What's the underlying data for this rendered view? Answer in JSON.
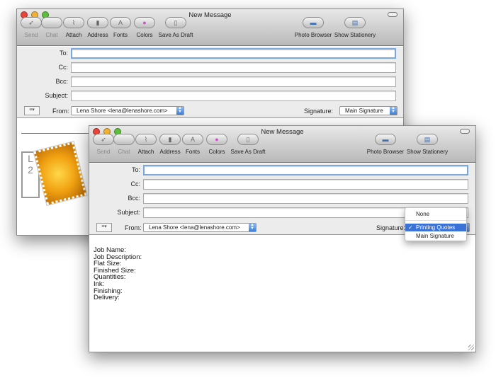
{
  "colors": {
    "close": "#e8443a",
    "minimize": "#f0b234",
    "zoom": "#5dbf3b",
    "accent": "#3a72d8"
  },
  "window_title": "New Message",
  "toolbar": {
    "left": [
      {
        "label": "Send",
        "icon": "send-icon",
        "enabled": false
      },
      {
        "label": "Chat",
        "icon": "chat-icon",
        "enabled": false
      },
      {
        "label": "Attach",
        "icon": "paperclip-icon",
        "enabled": true
      },
      {
        "label": "Address",
        "icon": "address-book-icon",
        "enabled": true
      },
      {
        "label": "Fonts",
        "icon": "fonts-icon",
        "enabled": true
      },
      {
        "label": "Colors",
        "icon": "color-wheel-icon",
        "enabled": true
      },
      {
        "label": "Save As Draft",
        "icon": "draft-icon",
        "enabled": true
      }
    ],
    "right": [
      {
        "label": "Photo Browser",
        "icon": "photo-icon"
      },
      {
        "label": "Show Stationery",
        "icon": "stationery-icon"
      }
    ]
  },
  "fields": {
    "to": "To:",
    "cc": "Cc:",
    "bcc": "Bcc:",
    "subject": "Subject:",
    "from": "From:",
    "signature": "Signature:"
  },
  "from_value": "Lena Shore <lena@lenashore.com>",
  "back_window": {
    "signature_value": "Main Signature"
  },
  "front_window": {
    "signature_menu": {
      "options": [
        "None",
        "Printing Quotes",
        "Main Signature"
      ],
      "selected": "Printing Quotes"
    },
    "body_lines": [
      "Job Name:",
      "Job Description:",
      "Flat Size:",
      "Finished Size:",
      "Quantities:",
      "Ink:",
      "Finishing:",
      "Delivery:"
    ]
  }
}
